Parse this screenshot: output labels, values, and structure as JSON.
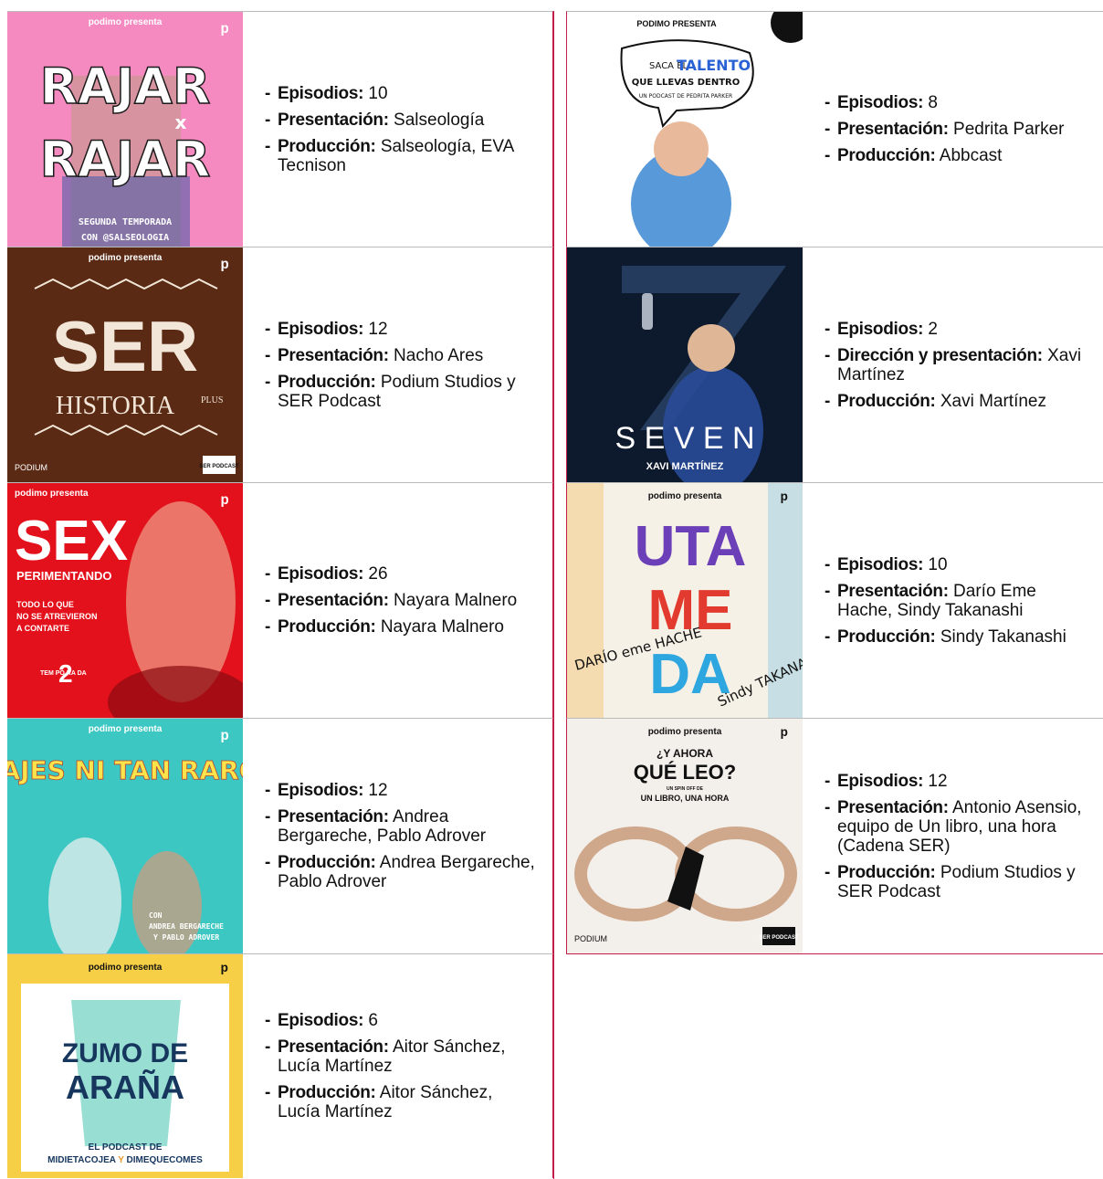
{
  "covers": {
    "rajar": {
      "top": "podimo presenta",
      "title_a": "RAJAR",
      "title_b": "RAJAR",
      "x": "x",
      "sub1": "SEGUNDA TEMPORADA",
      "sub2": "CON @SALSEOLOGIA"
    },
    "ser": {
      "top": "podimo presenta",
      "title": "SER",
      "sub": "HISTORIA",
      "plus": "PLUS",
      "brand": "PODIUM",
      "badge": "SER PODCAST"
    },
    "sex": {
      "top": "podimo presenta",
      "title": "SEX",
      "sub": "PERIMENTANDO",
      "l1": "TODO LO QUE",
      "l2": "NO SE ATREVIERON",
      "l3": "A CONTARTE",
      "temp": "TEM PO RA DA",
      "num": "2"
    },
    "viajes": {
      "top": "podimo presenta",
      "title": "VIAJES NI TAN RAROS",
      "con": "CON",
      "n1": "ANDREA BERGARECHE",
      "n2": "Y PABLO ADROVER"
    },
    "zumo": {
      "top": "podimo presenta",
      "t1": "ZUMO DE",
      "t2": "ARAÑA",
      "s1": "EL PODCAST DE",
      "s2": "MIDIETACOJEA",
      "s3": "Y",
      "s4": "DIMEQUECOMES"
    },
    "talento": {
      "top": "PODIMO PRESENTA",
      "l1": "SACA EL",
      "l2": "TALENTO",
      "l3": "QUE LLEVAS DENTRO",
      "l4": "UN PODCAST DE PEDRITA PARKER"
    },
    "seven": {
      "title": "S E V E N",
      "name": "XAVI MARTÍNEZ"
    },
    "utameda": {
      "top": "podimo presenta",
      "t1": "UTA",
      "t2": "ME",
      "t3": "DA",
      "n1": "DARÍO eme HACHE",
      "n2": "Sindy TAKANASHI"
    },
    "leo": {
      "top": "podimo presenta",
      "t1": "¿Y AHORA",
      "t2": "QUÉ LEO?",
      "t3": "UN SPIN OFF DE",
      "t4": "UN LIBRO, UNA HORA",
      "brand": "PODIUM",
      "badge": "SER PODCAST"
    }
  },
  "left": [
    {
      "items": [
        {
          "label": "Episodios:",
          "value": "10"
        },
        {
          "label": "Presentación:",
          "value": "Salseología"
        },
        {
          "label": "Producción:",
          "value": "Salseología, EVA Tecnison"
        }
      ]
    },
    {
      "items": [
        {
          "label": "Episodios:",
          "value": "12"
        },
        {
          "label": "Presentación:",
          "value": "Nacho Ares"
        },
        {
          "label": "Producción:",
          "value": "Podium Studios y SER Podcast"
        }
      ]
    },
    {
      "items": [
        {
          "label": "Episodios:",
          "value": "26"
        },
        {
          "label": "Presentación:",
          "value": "Nayara Malnero"
        },
        {
          "label": "Producción:",
          "value": "Nayara Malnero"
        }
      ]
    },
    {
      "items": [
        {
          "label": "Episodios:",
          "value": "12"
        },
        {
          "label": "Presentación:",
          "value": "Andrea Bergareche, Pablo Adrover"
        },
        {
          "label": "Producción:",
          "value": "Andrea Bergareche, Pablo Adrover"
        }
      ]
    },
    {
      "items": [
        {
          "label": "Episodios:",
          "value": "6"
        },
        {
          "label": "Presentación:",
          "value": "Aitor Sánchez, Lucía Martínez"
        },
        {
          "label": "Producción:",
          "value": "Aitor Sánchez, Lucía Martínez"
        }
      ]
    }
  ],
  "right": [
    {
      "items": [
        {
          "label": "Episodios:",
          "value": "8"
        },
        {
          "label": "Presentación:",
          "value": "Pedrita Parker"
        },
        {
          "label": "Producción:",
          "value": "Abbcast"
        }
      ]
    },
    {
      "items": [
        {
          "label": "Episodios:",
          "value": "2"
        },
        {
          "label": "Dirección y presentación:",
          "value": "Xavi Martínez"
        },
        {
          "label": "Producción:",
          "value": "Xavi Martínez"
        }
      ]
    },
    {
      "items": [
        {
          "label": "Episodios:",
          "value": "10"
        },
        {
          "label": "Presentación:",
          "value": "Darío Eme Hache, Sindy Takanashi"
        },
        {
          "label": "Producción:",
          "value": "Sindy Takanashi"
        }
      ]
    },
    {
      "items": [
        {
          "label": "Episodios:",
          "value": "12"
        },
        {
          "label": "Presentación:",
          "value": "Antonio Asensio, equipo de Un libro, una hora (Cadena SER)"
        },
        {
          "label": "Producción:",
          "value": "Podium Studios y SER Podcast"
        }
      ]
    }
  ]
}
